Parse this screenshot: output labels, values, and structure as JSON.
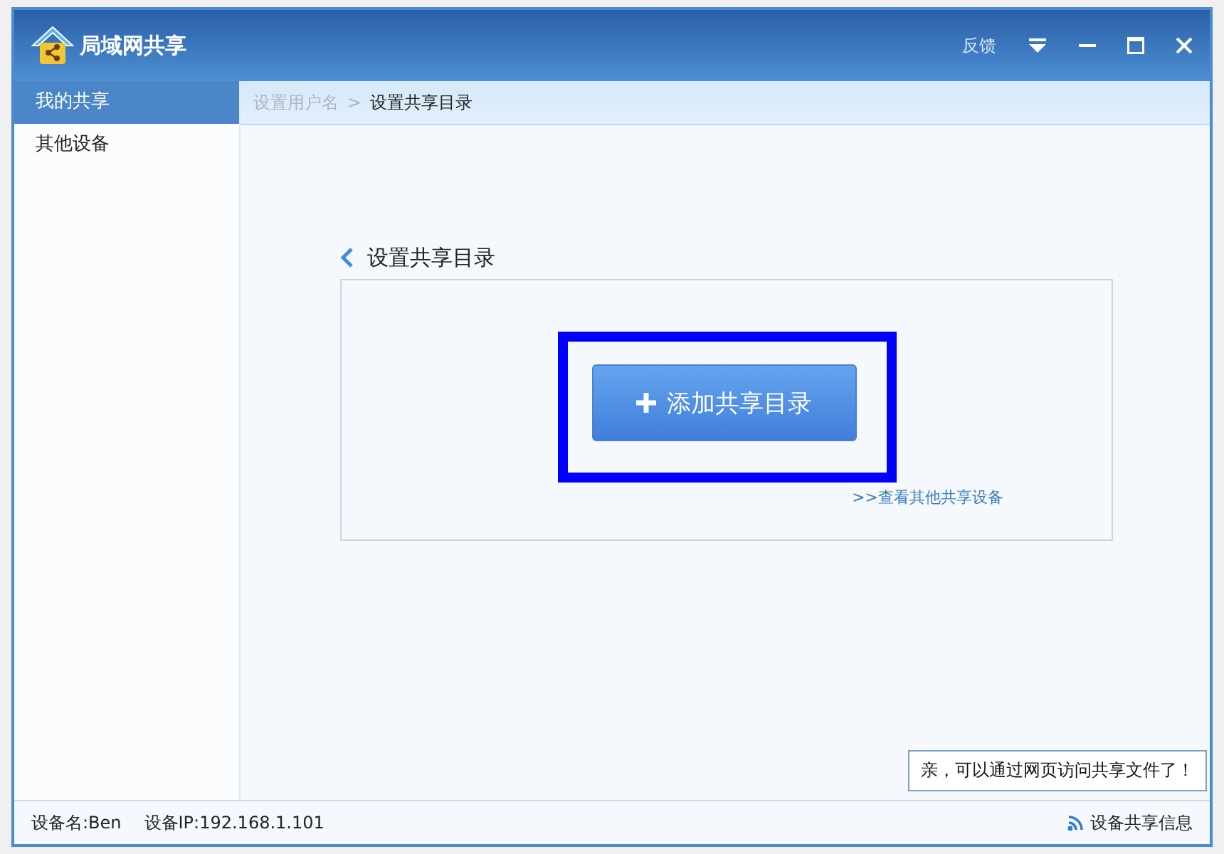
{
  "window": {
    "title": "局域网共享",
    "feedback": "反馈"
  },
  "sidebar": {
    "items": [
      {
        "label": "我的共享",
        "selected": true
      },
      {
        "label": "其他设备",
        "selected": false
      }
    ]
  },
  "breadcrumb": [
    {
      "label": "设置用户名",
      "current": false
    },
    {
      "label": ">",
      "current": false
    },
    {
      "label": "设置共享目录",
      "current": true
    }
  ],
  "section": {
    "title": "设置共享目录",
    "add_button": "添加共享目录",
    "link": ">>查看其他共享设备"
  },
  "tooltip": "亲，可以通过网页访问共享文件了！",
  "status_bar": {
    "device_name": "设备名:Ben",
    "device_ip": "设备IP:192.168.1.101",
    "share_info": "设备共享信息"
  }
}
